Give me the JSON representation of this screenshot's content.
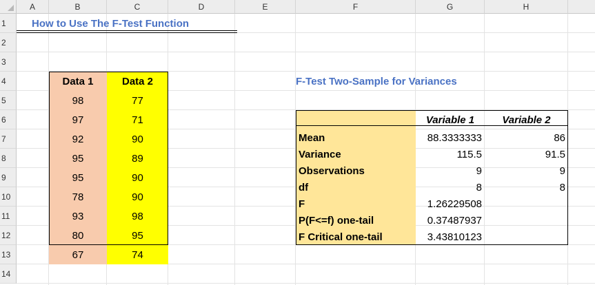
{
  "columns": [
    "A",
    "B",
    "C",
    "D",
    "E",
    "F",
    "G",
    "H"
  ],
  "rows": [
    "1",
    "2",
    "3",
    "4",
    "5",
    "6",
    "7",
    "8",
    "9",
    "10",
    "11",
    "12",
    "13",
    "14"
  ],
  "title": "How to Use The F-Test Function",
  "data_table": {
    "headers": [
      "Data 1",
      "Data 2"
    ],
    "rows": [
      [
        "98",
        "77"
      ],
      [
        "97",
        "71"
      ],
      [
        "92",
        "90"
      ],
      [
        "95",
        "89"
      ],
      [
        "95",
        "90"
      ],
      [
        "78",
        "90"
      ],
      [
        "93",
        "98"
      ],
      [
        "80",
        "95"
      ],
      [
        "67",
        "74"
      ]
    ],
    "colors": {
      "data1": "#f8cbad",
      "data2": "#ffff00"
    }
  },
  "ftest": {
    "title": "F-Test Two-Sample for Variances",
    "headers": [
      "",
      "Variable 1",
      "Variable 2"
    ],
    "rows": [
      [
        "Mean",
        "88.3333333",
        "86"
      ],
      [
        "Variance",
        "115.5",
        "91.5"
      ],
      [
        "Observations",
        "9",
        "9"
      ],
      [
        "df",
        "8",
        "8"
      ],
      [
        "F",
        "1.26229508",
        ""
      ],
      [
        "P(F<=f) one-tail",
        "0.37487937",
        ""
      ],
      [
        "F Critical one-tail",
        "3.43810123",
        ""
      ]
    ],
    "label_color": "#ffe699"
  },
  "accent": "#4a72c4"
}
